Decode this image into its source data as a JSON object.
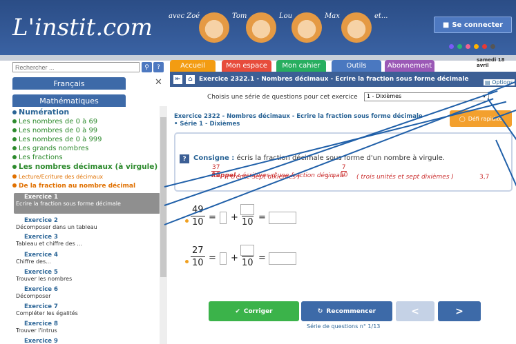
{
  "header": {
    "logo": "L'instit.com",
    "kids": [
      "avec Zoé",
      "Tom",
      "Lou",
      "Max",
      "et..."
    ],
    "login": "Se connecter",
    "dot_colors": [
      "#7a5af8",
      "#2bb673",
      "#f06292",
      "#ffb300",
      "#e53935",
      "#555555"
    ]
  },
  "search": {
    "placeholder": "Rechercher ..."
  },
  "sidebar": {
    "subject1": "Français",
    "subject2": "Mathématiques",
    "section": "Numération",
    "items": [
      "Les nombres de 0 à 69",
      "Les nombres de 0 à 99",
      "Les nombres de 0 à 999",
      "Les grands nombres",
      "Les fractions"
    ],
    "active_item": "Les nombres décimaux (à virgule)",
    "sub_items": [
      "Lecture/Ecriture des décimaux"
    ],
    "active_sub": "De la fraction au nombre décimal",
    "exercises": [
      {
        "title": "Exercice 1",
        "desc": "Ecrire la fraction sous forme décimale"
      },
      {
        "title": "Exercice 2",
        "desc": "Décomposer dans un tableau"
      },
      {
        "title": "Exercice 3",
        "desc": "Tableau et chiffre des ..."
      },
      {
        "title": "Exercice 4",
        "desc": "Chiffre des..."
      },
      {
        "title": "Exercice 5",
        "desc": "Trouver les nombres"
      },
      {
        "title": "Exercice 6",
        "desc": "Décomposer"
      },
      {
        "title": "Exercice 7",
        "desc": "Compléter les égalités"
      },
      {
        "title": "Exercice 8",
        "desc": "Trouver l'intrus"
      },
      {
        "title": "Exercice 9",
        "desc": ""
      }
    ]
  },
  "tabs": [
    {
      "label": "Accueil",
      "color": "#f39c12"
    },
    {
      "label": "Mon espace",
      "color": "#e74c3c"
    },
    {
      "label": "Mon cahier",
      "color": "#27ae60"
    },
    {
      "label": "Outils",
      "color": "#4a78c0"
    },
    {
      "label": "Abonnement",
      "color": "#9b59b6"
    }
  ],
  "date": "samedi 18 avril",
  "exercise": {
    "bar_title": "Exercice 2322.1 - Nombres décimaux - Ecrire la fraction sous forme décimale",
    "options": "Options",
    "choose_label": "Choisis une série de questions pour cet exercice",
    "select_value": "1 - Dixièmes",
    "title": "Exercice 2322 - Nombres décimaux - Ecrire la fraction sous forme décimale",
    "serie": "• Série 1 - Dixièmes",
    "defi": "Défi rapidité",
    "consigne_label": "Consigne :",
    "consigne_text": "écris la fraction décimale sous forme d'un nombre à virgule.",
    "rappel_label": "Rappel :",
    "rappel_text": "écritures d'une fraction décimale",
    "ex1_num": "37",
    "ex1_den": "10",
    "ex1_words": "( trente-sept dixièmes )",
    "ex2_int": "3 +",
    "ex2_num": "7",
    "ex2_den": "10",
    "ex2_words": "( trois unités et sept dixièmes )",
    "ex2_val": "3,7",
    "questions": [
      {
        "num": "49",
        "den": "10"
      },
      {
        "num": "27",
        "den": "10"
      }
    ],
    "q_den": "10",
    "btn_correct": "Corriger",
    "btn_restart": "Recommencer",
    "btn_prev": "<",
    "btn_next": ">",
    "serie_status": "Série de questions n° 1/13"
  }
}
